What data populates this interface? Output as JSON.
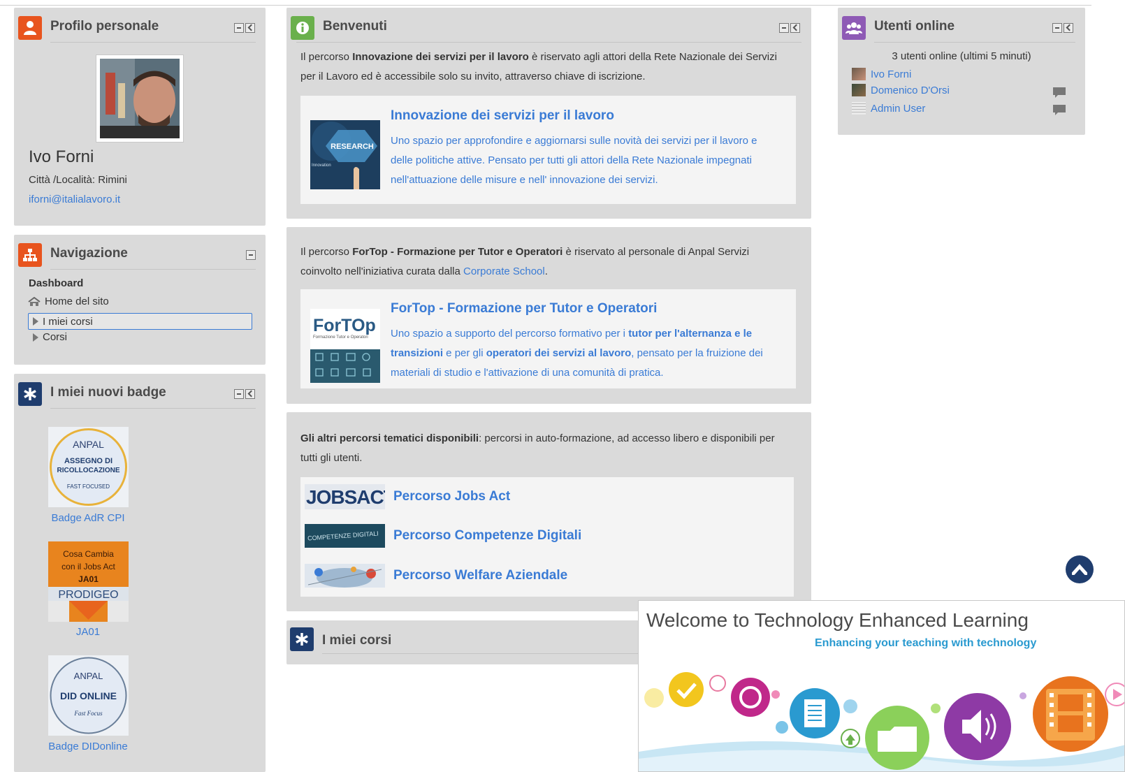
{
  "profile": {
    "title": "Profilo personale",
    "name": "Ivo Forni",
    "city": "Città /Località: Rimini",
    "email": "iforni@italialavoro.it"
  },
  "navigation": {
    "title": "Navigazione",
    "dashboard": "Dashboard",
    "home": "Home del sito",
    "my_courses": "I miei corsi",
    "courses": "Corsi"
  },
  "badges": {
    "title": "I miei nuovi badge",
    "items": [
      {
        "label": "Badge AdR CPI",
        "image_text": [
          "ANPAL",
          "ASSEGNO DI",
          "RICOLLOCAZIONE",
          "FAST FOCUSED"
        ]
      },
      {
        "label": "JA01",
        "image_text": [
          "Cosa Cambia",
          "con il Jobs Act",
          "JA01",
          "PRODIGEO"
        ]
      },
      {
        "label": "Badge DIDonline",
        "image_text": [
          "ANPAL",
          "DID ONLINE",
          "Fast Focus"
        ]
      }
    ]
  },
  "welcome": {
    "title": "Benvenuti",
    "intro_pre": "Il percorso ",
    "intro_bold": "Innovazione dei servizi per il lavoro",
    "intro_post": " è riservato agli attori della Rete Nazionale dei Servizi per il Lavoro ed è accessibile solo su invito, attraverso chiave di iscrizione.",
    "card_title": "Innovazione dei servizi per il lavoro",
    "card_desc": "Uno spazio per approfondire e aggiornarsi sulle novità dei servizi per il lavoro e delle politiche attive. Pensato per tutti gli attori della Rete Nazionale impegnati nell'attuazione delle misure e nell' innovazione dei servizi.",
    "card_image_text": [
      "RESEARCH",
      "Innovation"
    ]
  },
  "fortop": {
    "intro_pre": "Il percorso ",
    "intro_bold": "ForTop - Formazione per Tutor e Operatori",
    "intro_mid": " è riservato al personale di Anpal Servizi coinvolto nell'iniziativa curata dalla ",
    "intro_link": "Corporate School",
    "intro_end": ".",
    "card_title": "ForTop - Formazione per Tutor e Operatori",
    "desc_1": "Uno spazio a supporto del percorso formativo per i ",
    "desc_b1": "tutor per l'alternanza e le transizioni",
    "desc_2": " e per gli ",
    "desc_b2": "operatori dei servizi al lavoro",
    "desc_3": ", pensato per la fruizione dei materiali di studio e l'attivazione di una comunità di pratica.",
    "logo_text": "ForTOp",
    "logo_sub": "Formazione Tutor e Operatori"
  },
  "others": {
    "intro_bold": "Gli altri percorsi tematici disponibili",
    "intro_rest": ": percorsi in auto-formazione, ad accesso libero e disponibili per tutti gli utenti.",
    "courses": [
      {
        "label": "Percorso Jobs Act",
        "thumb_text": "JOBSACT"
      },
      {
        "label": "Percorso Competenze Digitali",
        "thumb_text": "COMPETENZE DIGITALI"
      },
      {
        "label": "Percorso Welfare Aziendale",
        "thumb_text": ""
      }
    ]
  },
  "mycourses": {
    "title": "I miei corsi"
  },
  "online": {
    "title": "Utenti online",
    "summary": "3 utenti online (ultimi 5 minuti)",
    "users": [
      "Ivo Forni",
      "Domenico D'Orsi",
      "Admin User"
    ]
  },
  "banner": {
    "title": "Welcome to Technology Enhanced Learning",
    "subtitle": "Enhancing your teaching with technology"
  },
  "colors": {
    "accent_orange": "#e8541e",
    "accent_green": "#6ab04c",
    "accent_purple": "#8e5ab5",
    "accent_navy": "#1f3d6e",
    "link": "#3a7bd5",
    "block_bg": "#dadada"
  }
}
